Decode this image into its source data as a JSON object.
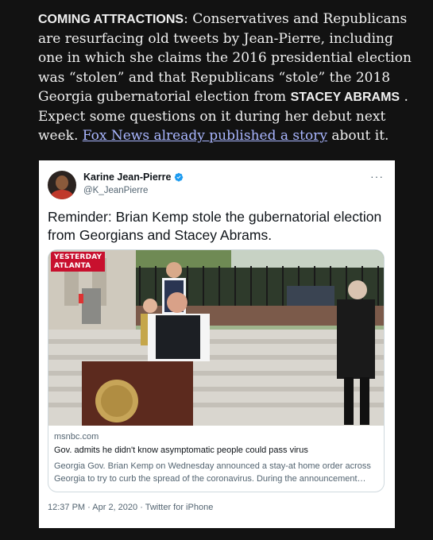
{
  "article": {
    "lead": "COMING ATTRACTIONS",
    "text1": ": Conservatives and Republicans are resurfacing old tweets by Jean-Pierre, including one in which she claims the 2016 presidential election was “stolen” and that Republicans “stole” the 2018 Georgia gubernatorial election from ",
    "name_bold": "STACEY ABRAMS",
    "text2": " . Expect some questions on it during her debut next week. ",
    "link_text": "Fox News already published a story",
    "text3": " about it."
  },
  "tweet": {
    "display_name": "Karine Jean-Pierre",
    "handle": "@K_JeanPierre",
    "more_icon": "more-icon",
    "verified_icon": "verified-badge-icon",
    "verified_color": "#1d9bf0",
    "text": "Reminder: Brian Kemp stole the gubernatorial election from  Georgians and Stacey Abrams.",
    "card": {
      "badge_line1": "YESTERDAY",
      "badge_line2": "ATLANTA",
      "domain": "msnbc.com",
      "title": "Gov. admits he didn't know asymptomatic people could pass virus",
      "description": "Georgia Gov. Brian Kemp on Wednesday announced a stay-at home order across Georgia to try to curb the spread of the coronavirus. During the announcement…"
    },
    "time": "12:37 PM",
    "sep1": " · ",
    "date": "Apr 2, 2020",
    "sep2": " · ",
    "source": "Twitter for iPhone"
  },
  "colors": {
    "page_bg": "#121212",
    "link": "#a9b6ff",
    "badge_red": "#c8102e"
  }
}
